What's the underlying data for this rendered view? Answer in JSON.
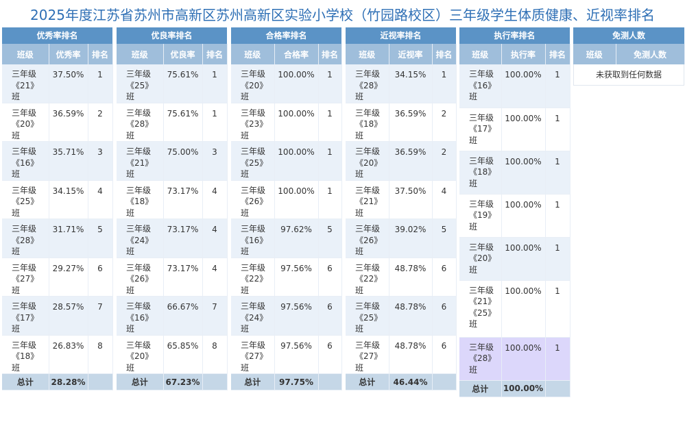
{
  "title": "2025年度江苏省苏州市高新区苏州高新区实验小学校（竹园路校区）三年级学生体质健康、近视率排名",
  "panels": [
    {
      "name": "优秀率排名",
      "headers": [
        "班级",
        "优秀率",
        "排名"
      ],
      "rows": [
        [
          "三年级《21》班",
          "37.50%",
          "1"
        ],
        [
          "三年级《20》班",
          "36.59%",
          "2"
        ],
        [
          "三年级《16》班",
          "35.71%",
          "3"
        ],
        [
          "三年级《25》班",
          "34.15%",
          "4"
        ],
        [
          "三年级《28》班",
          "31.71%",
          "5"
        ],
        [
          "三年级《27》班",
          "29.27%",
          "6"
        ],
        [
          "三年级《17》班",
          "28.57%",
          "7"
        ],
        [
          "三年级《18》班",
          "26.83%",
          "8"
        ]
      ],
      "total": [
        "总计",
        "28.28%"
      ]
    },
    {
      "name": "优良率排名",
      "headers": [
        "班级",
        "优良率",
        "排名"
      ],
      "rows": [
        [
          "三年级《25》班",
          "75.61%",
          "1"
        ],
        [
          "三年级《28》班",
          "75.61%",
          "1"
        ],
        [
          "三年级《21》班",
          "75.00%",
          "3"
        ],
        [
          "三年级《18》班",
          "73.17%",
          "4"
        ],
        [
          "三年级《24》班",
          "73.17%",
          "4"
        ],
        [
          "三年级《26》班",
          "73.17%",
          "4"
        ],
        [
          "三年级《16》班",
          "66.67%",
          "7"
        ],
        [
          "三年级《20》班",
          "65.85%",
          "8"
        ]
      ],
      "total": [
        "总计",
        "67.23%"
      ]
    },
    {
      "name": "合格率排名",
      "headers": [
        "班级",
        "合格率",
        "排名"
      ],
      "rows": [
        [
          "三年级《20》班",
          "100.00%",
          "1"
        ],
        [
          "三年级《23》班",
          "100.00%",
          "1"
        ],
        [
          "三年级《25》班",
          "100.00%",
          "1"
        ],
        [
          "三年级《26》班",
          "100.00%",
          "1"
        ],
        [
          "三年级《16》班",
          "97.62%",
          "5"
        ],
        [
          "三年级《22》班",
          "97.56%",
          "6"
        ],
        [
          "三年级《24》班",
          "97.56%",
          "6"
        ],
        [
          "三年级《27》班",
          "97.56%",
          "6"
        ]
      ],
      "total": [
        "总计",
        "97.75%"
      ]
    },
    {
      "name": "近视率排名",
      "headers": [
        "班级",
        "近视率",
        "排名"
      ],
      "rows": [
        [
          "三年级《28》班",
          "34.15%",
          "1"
        ],
        [
          "三年级《18》班",
          "36.59%",
          "2"
        ],
        [
          "三年级《20》班",
          "36.59%",
          "2"
        ],
        [
          "三年级《21》班",
          "37.50%",
          "4"
        ],
        [
          "三年级《26》班",
          "39.02%",
          "5"
        ],
        [
          "三年级《22》班",
          "48.78%",
          "6"
        ],
        [
          "三年级《25》班",
          "48.78%",
          "6"
        ],
        [
          "三年级《27》班",
          "48.78%",
          "6"
        ]
      ],
      "total": [
        "总计",
        "46.44%"
      ]
    },
    {
      "name": "执行率排名",
      "headers": [
        "班级",
        "执行率",
        "排名"
      ],
      "rows": [
        [
          "三年级《16》班",
          "100.00%",
          "1"
        ],
        [
          "三年级《17》班",
          "100.00%",
          "1"
        ],
        [
          "三年级《18》班",
          "100.00%",
          "1"
        ],
        [
          "三年级《19》班",
          "100.00%",
          "1"
        ],
        [
          "三年级《20》班",
          "100.00%",
          "1"
        ],
        [
          "三年级《21》《25》班",
          "100.00%",
          "1"
        ],
        [
          "三年级《28》班",
          "100.00%",
          "1"
        ]
      ],
      "total": [
        "总计",
        "100.00%"
      ]
    }
  ],
  "exempt": {
    "name": "免测人数",
    "headers": [
      "班级",
      "免测人数"
    ],
    "empty_text": "未获取到任何数据"
  }
}
